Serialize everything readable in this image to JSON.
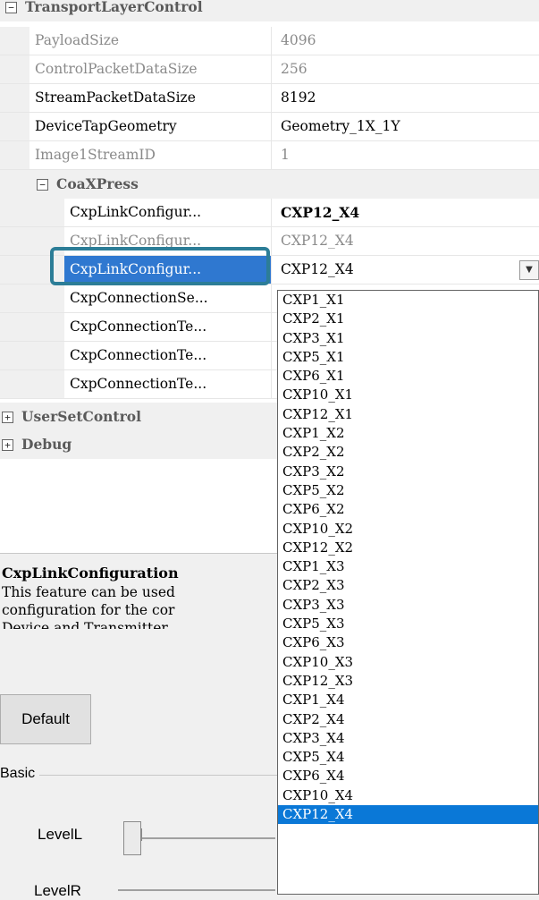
{
  "grid": {
    "category_transport": "TransportLayerControl",
    "category_coaxpress": "CoaXPress",
    "category_userset": "UserSetControl",
    "category_debug": "Debug",
    "collapse_glyph": "−",
    "expand_glyph": "+",
    "rows": [
      {
        "name": "PayloadSize",
        "value": "4096"
      },
      {
        "name": "ControlPacketDataSize",
        "value": "256"
      },
      {
        "name": "StreamPacketDataSize",
        "value": "8192"
      },
      {
        "name": "DeviceTapGeometry",
        "value": "Geometry_1X_1Y"
      },
      {
        "name": "Image1StreamID",
        "value": "1"
      }
    ],
    "coax_rows": [
      {
        "name": "CxpLinkConfigur...",
        "value": "CXP12_X4"
      },
      {
        "name": "CxpLinkConfigur...",
        "value": "CXP12_X4"
      },
      {
        "name": "CxpLinkConfigur...",
        "value": "CXP12_X4"
      },
      {
        "name": "CxpConnectionSe...",
        "value": ""
      },
      {
        "name": "CxpConnectionTe...",
        "value": ""
      },
      {
        "name": "CxpConnectionTe...",
        "value": ""
      },
      {
        "name": "CxpConnectionTe...",
        "value": ""
      }
    ],
    "dropdown_arrow": "▼"
  },
  "description": {
    "title": "CxpLinkConfiguration",
    "line1": "This feature can be used",
    "line2": "configuration for the cor",
    "line3": "Device and Transmitter"
  },
  "controls": {
    "default_label": "Default",
    "basic_label": "Basic",
    "level_l": "LevelL",
    "level_r": "LevelR"
  },
  "dropdown_options": [
    "CXP1_X1",
    "CXP2_X1",
    "CXP3_X1",
    "CXP5_X1",
    "CXP6_X1",
    "CXP10_X1",
    "CXP12_X1",
    "CXP1_X2",
    "CXP2_X2",
    "CXP3_X2",
    "CXP5_X2",
    "CXP6_X2",
    "CXP10_X2",
    "CXP12_X2",
    "CXP1_X3",
    "CXP2_X3",
    "CXP3_X3",
    "CXP5_X3",
    "CXP6_X3",
    "CXP10_X3",
    "CXP12_X3",
    "CXP1_X4",
    "CXP2_X4",
    "CXP3_X4",
    "CXP5_X4",
    "CXP6_X4",
    "CXP10_X4",
    "CXP12_X4"
  ],
  "dropdown_selected": "CXP12_X4",
  "colors": {
    "selection": "#2f78d0",
    "dropdown_selection": "#0a78d7",
    "highlight_box": "#2c7d97"
  }
}
